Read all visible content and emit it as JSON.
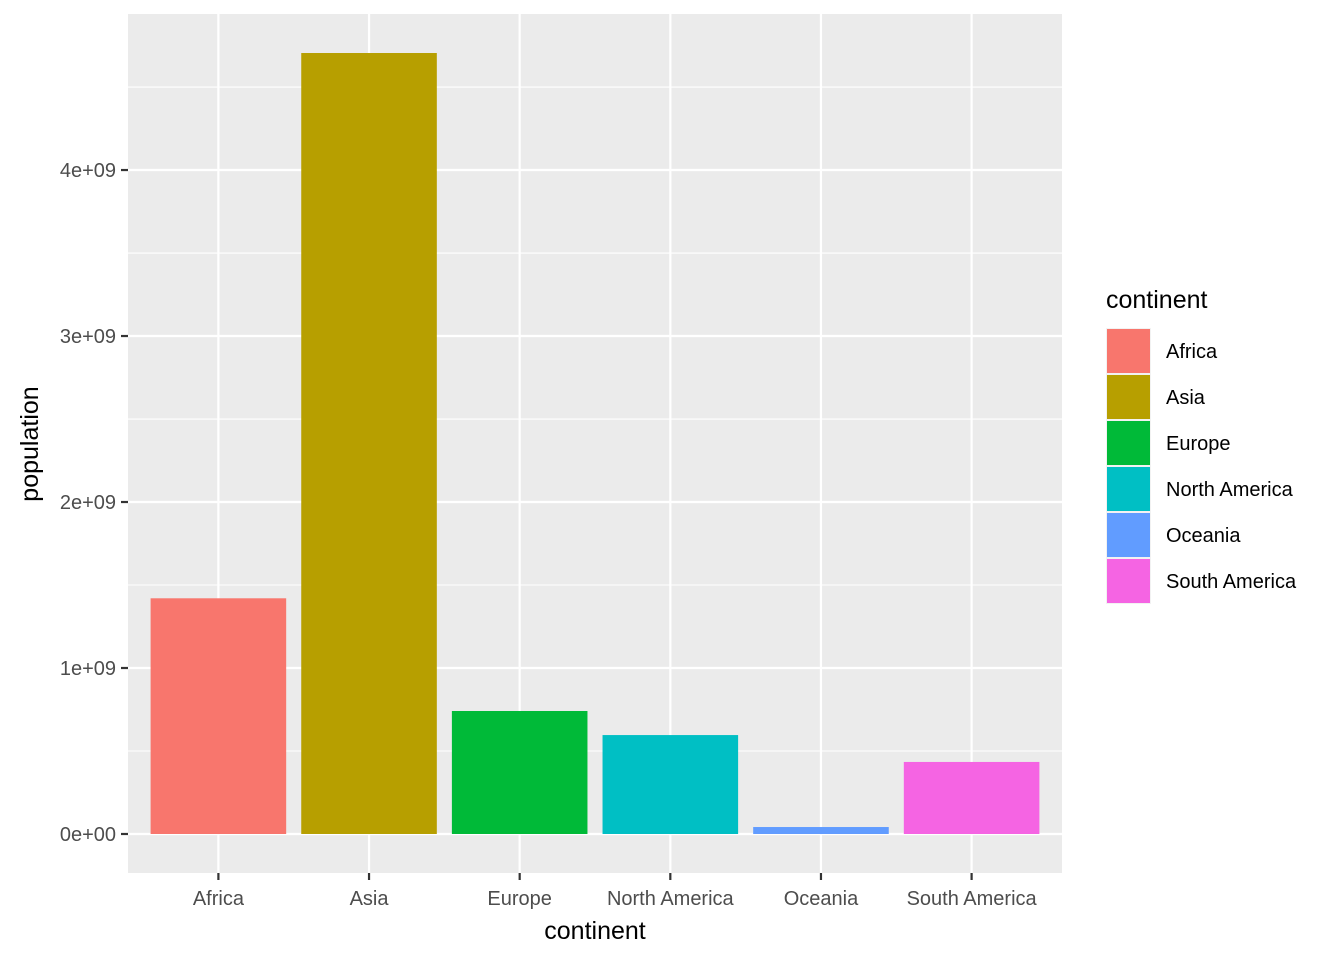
{
  "chart_data": {
    "type": "bar",
    "title": "",
    "xlabel": "continent",
    "ylabel": "population",
    "categories": [
      "Africa",
      "Asia",
      "Europe",
      "North America",
      "Oceania",
      "South America"
    ],
    "values": [
      1420000000,
      4705000000,
      741000000,
      596000000,
      42000000,
      434000000
    ],
    "colors": [
      "#F8766D",
      "#B79F00",
      "#00BA38",
      "#00BFC4",
      "#619CFF",
      "#F564E3"
    ],
    "ylim": [
      -235000000,
      4940000000
    ],
    "yticks": [
      0,
      1000000000,
      2000000000,
      3000000000,
      4000000000
    ],
    "ytick_labels": [
      "0e+00",
      "1e+09",
      "2e+09",
      "3e+09",
      "4e+09"
    ],
    "grid": true,
    "panel_background": "#EBEBEB",
    "legend": {
      "title": "continent",
      "position": "right",
      "entries": [
        "Africa",
        "Asia",
        "Europe",
        "North America",
        "Oceania",
        "South America"
      ]
    }
  }
}
